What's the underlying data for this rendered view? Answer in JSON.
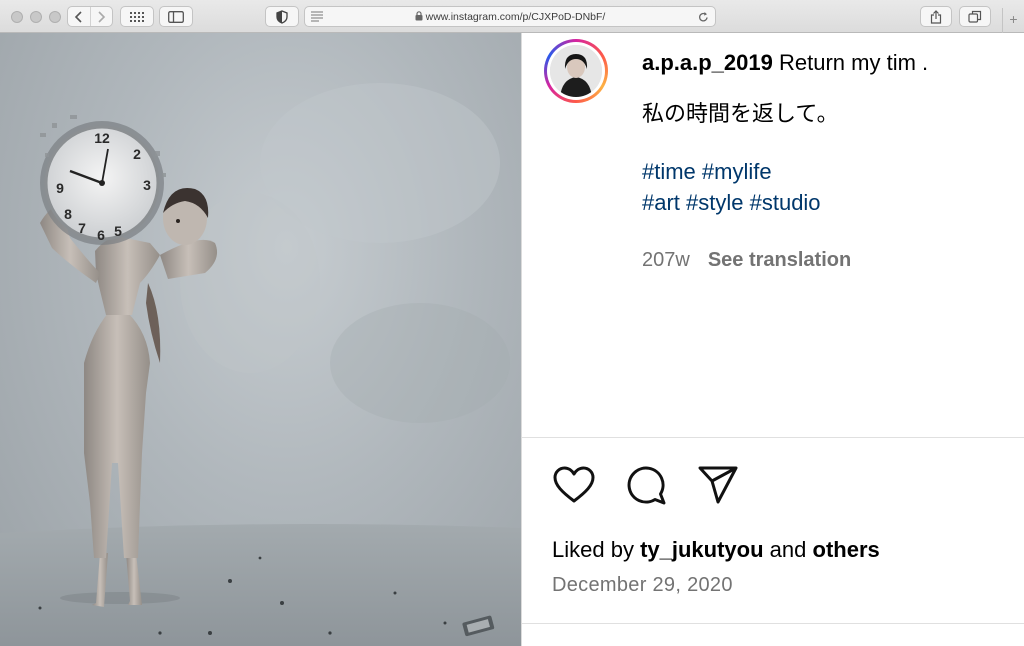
{
  "browser": {
    "url": "www.instagram.com/p/CJXPoD-DNbF/",
    "new_tab_label": "+"
  },
  "post": {
    "username": "a.p.a.p_2019",
    "caption_text": "Return my tim .",
    "caption_jp": "私の時間を返して。",
    "hashtags_line1": "#time #mylife",
    "hashtags_line2": "#art #style #studio",
    "age": "207w",
    "see_translation": "See translation",
    "liked_by_prefix": "Liked by",
    "liked_by_user": "ty_jukutyou",
    "liked_by_and": "and",
    "liked_by_others": "others",
    "date": "December 29, 2020",
    "clock_numerals": [
      "12",
      "2",
      "3",
      "5",
      "6",
      "7",
      "8",
      "9"
    ]
  },
  "icons": [
    "sidebar-toggle-icon",
    "shield-icon",
    "reader-icon",
    "lock-icon",
    "reload-icon",
    "share-icon",
    "tabs-icon",
    "heart-icon",
    "comment-icon",
    "send-icon"
  ],
  "colors": {
    "hashtag": "#00376b",
    "secondary": "#737373",
    "ring_start": "#d6249f",
    "ring_mid": "#fdb244"
  }
}
